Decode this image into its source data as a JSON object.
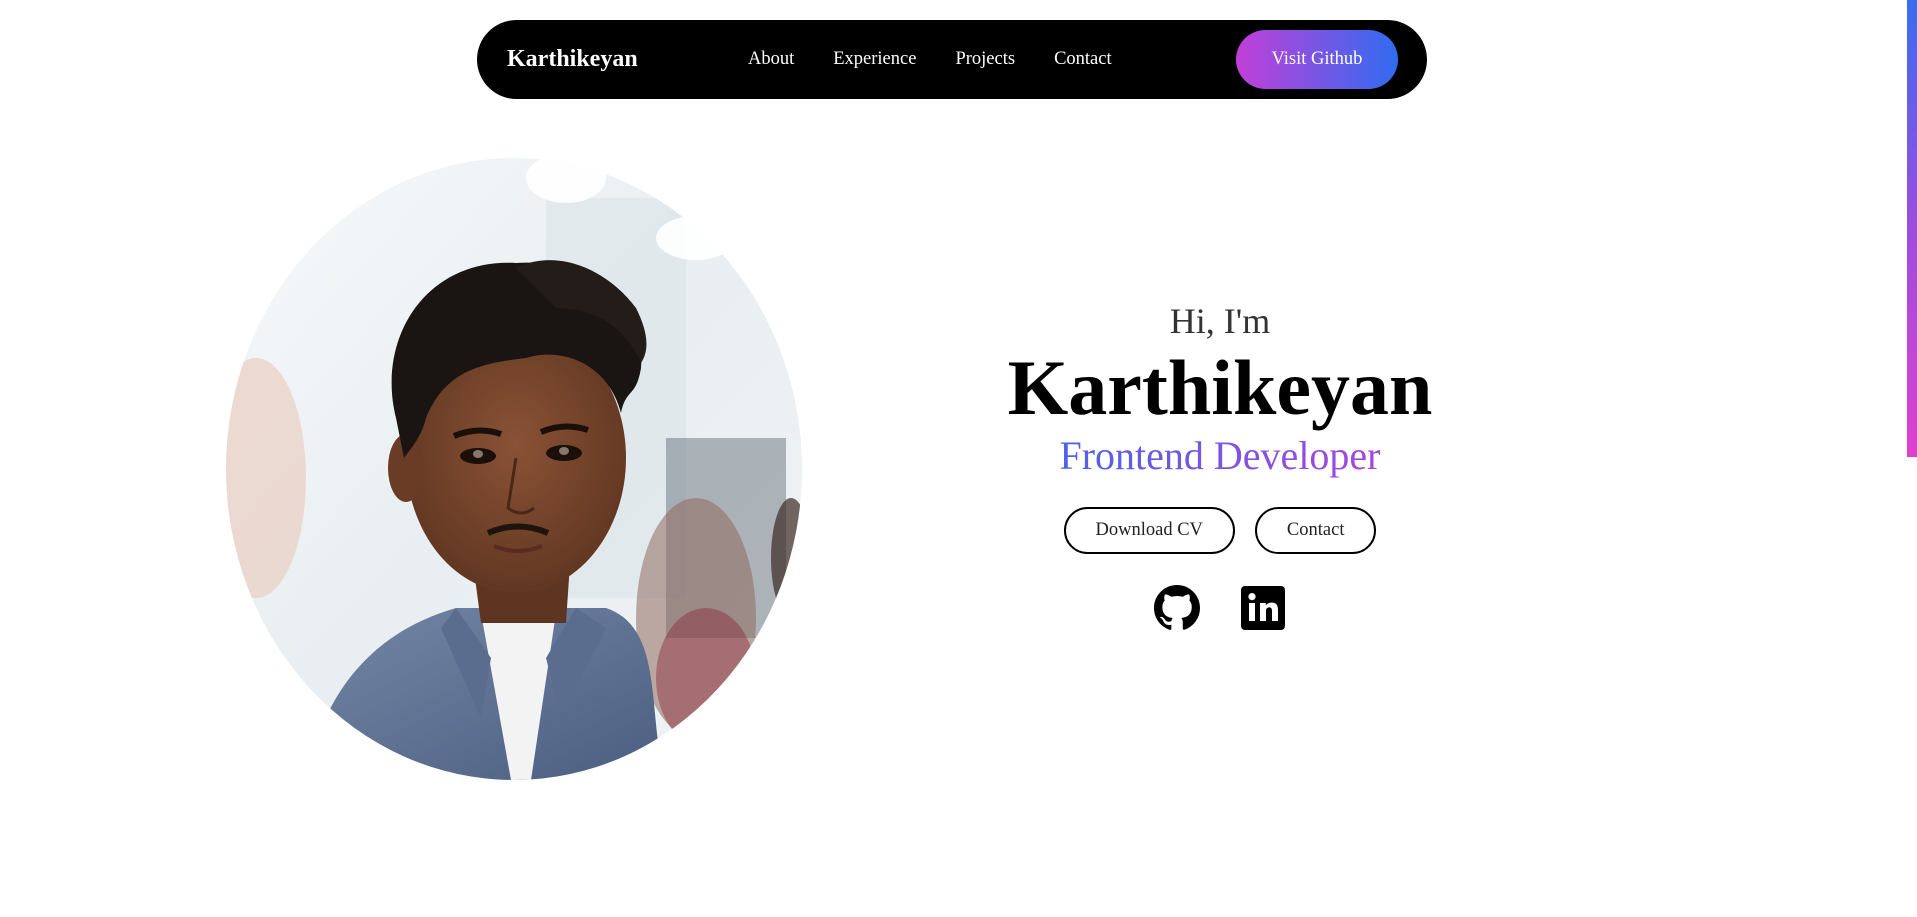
{
  "nav": {
    "brand": "Karthikeyan",
    "links": [
      "About",
      "Experience",
      "Projects",
      "Contact"
    ],
    "cta": "Visit Github"
  },
  "hero": {
    "greeting": "Hi, I'm",
    "name": "Karthikeyan",
    "role": "Frontend Developer",
    "buttons": {
      "download_cv": "Download CV",
      "contact": "Contact"
    },
    "social_icons": [
      "github-icon",
      "linkedin-icon"
    ]
  },
  "colors": {
    "nav_bg": "#000000",
    "gradient_start": "#c23fd8",
    "gradient_end": "#2f6cf0",
    "text": "#000000"
  }
}
